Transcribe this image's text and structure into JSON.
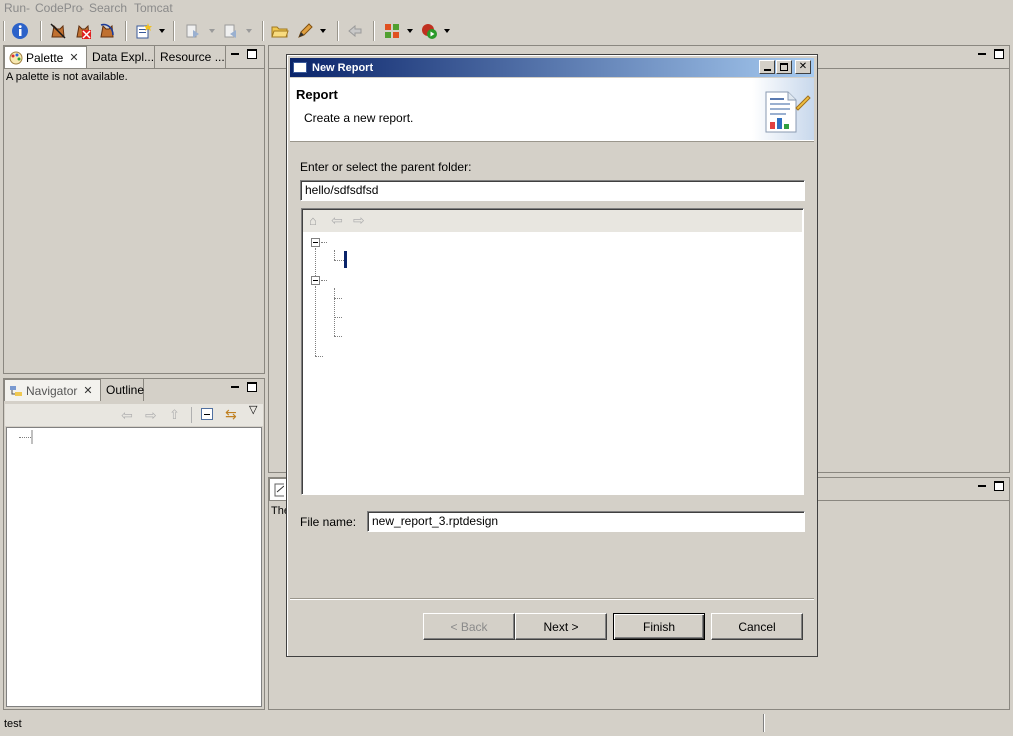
{
  "menubar": {
    "items": [
      "Run",
      "CodePro",
      "Search",
      "Tomcat"
    ]
  },
  "toolbar": {
    "buttons": [
      {
        "icon": "info-icon"
      },
      {
        "icon": "cat-run-icon"
      },
      {
        "icon": "cat-stop-icon"
      },
      {
        "icon": "cat-restart-icon"
      },
      {
        "icon": "new-wizard-icon"
      },
      {
        "icon": "next-annotation-icon"
      },
      {
        "icon": "prev-annotation-icon"
      },
      {
        "icon": "open-folder-icon"
      },
      {
        "icon": "pen-icon"
      },
      {
        "icon": "back-icon"
      },
      {
        "icon": "puzzle-icon"
      },
      {
        "icon": "run-debug-icon"
      }
    ]
  },
  "palette_view": {
    "tabs": [
      "Palette",
      "Data Expl...",
      "Resource ..."
    ],
    "message": "A palette is not available."
  },
  "navigator_view": {
    "tabs": [
      "Navigator",
      "Outline"
    ]
  },
  "editor_area": {
    "properties_text": "The"
  },
  "dialog": {
    "title": "New Report",
    "banner_title": "Report",
    "banner_description": "Create a new report.",
    "folder_label": "Enter or select the parent folder:",
    "folder_value": "hello/sdfsdfsd",
    "file_name_label": "File name:",
    "file_name_value": "new_report_3.rptdesign",
    "buttons": {
      "back": "< Back",
      "next": "Next >",
      "finish": "Finish",
      "cancel": "Cancel"
    }
  },
  "status": {
    "text": "test"
  },
  "colors": {
    "titlebar_start": "#0a246a",
    "titlebar_end": "#a6caf0",
    "chrome": "#d4d0c8"
  }
}
